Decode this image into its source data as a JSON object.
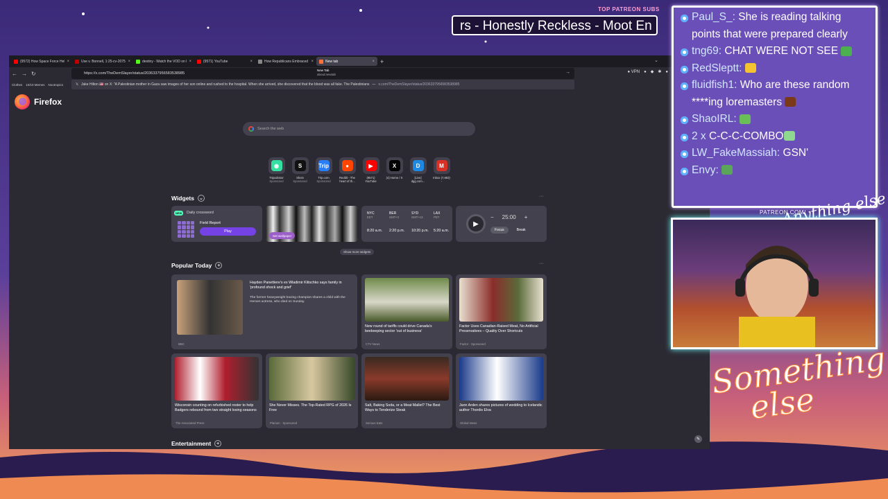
{
  "stream_overlay": {
    "patreon_subs_label": "TOP PATREON SUBS",
    "ticker_text": "rs - Honestly Reckless - Moot En",
    "patreon_url": "PATREON.COM/",
    "signature": "Anything else",
    "logo_text_line1": "Something",
    "logo_text_line2": "else",
    "chat": [
      {
        "user": "Paul_S_:",
        "text": " She is reading talking points that were prepared clearly",
        "emote": ""
      },
      {
        "user": "tng69:",
        "text": " CHAT WERE NOT SEE ",
        "emote": "frog-emote"
      },
      {
        "user": "RedSleptt:",
        "text": " ",
        "emote": "bee-emote"
      },
      {
        "user": "fluidfish1:",
        "text": " Who are these random ****ing loremasters ",
        "emote": "ball-emote"
      },
      {
        "user": "ShaoIRL:",
        "text": " ",
        "emote": "running-emote"
      },
      {
        "user": "2 x",
        "text": " C-C-C-COMBO",
        "emote": "combo-emote"
      },
      {
        "user": "LW_FakeMassiah:",
        "text": " GSN'",
        "emote": ""
      },
      {
        "user": "Envy:",
        "text": " ",
        "emote": "pepe-emote"
      }
    ]
  },
  "browser": {
    "tabs": [
      {
        "label": "(9572) How Space Force Helps",
        "color": "#ff0000"
      },
      {
        "label": "Use v. Bonnell, 1:25-cv-20757",
        "color": "#c00000"
      },
      {
        "label": "destiny - Watch the VOD on Kick",
        "color": "#53fc18"
      },
      {
        "label": "(9571) YouTube",
        "color": "#ff0000"
      },
      {
        "label": "How Republicans Embraced Bri",
        "color": "#888888"
      },
      {
        "label": "New tab",
        "color": "#ff7139"
      }
    ],
    "tooltip_title": "New Tab",
    "tooltip_url": "about:newtab",
    "url": "https://x.com/TheDemSlayer/status/2036337956583538985",
    "suggestion": "Jake Hilton 🇺🇸 on X: \"A Palestinian mother in Gaza saw images of her son online and rushed to the hospital. When she arrived, she discovered that the blood was all fake. The Palestinians",
    "suggestion_url": "x.com/TheDemSlayer/status/2036337956583538985",
    "vpn_label": "VPN",
    "bookmarks": [
      "Clothes",
      "10/10 Memes",
      "Nootropics"
    ],
    "brand": "Firefox",
    "search_placeholder": "Search the web",
    "shortcuts": [
      {
        "name": "Tripadvisor",
        "sub": "Sponsored",
        "glyph": "◉",
        "color": "#34e0a1"
      },
      {
        "name": "Shein",
        "sub": "Sponsored",
        "glyph": "S",
        "color": "#111111"
      },
      {
        "name": "Trip.com",
        "sub": "Sponsored",
        "glyph": "Trip",
        "color": "#287dfa"
      },
      {
        "name": "Reddit - The heart of th...",
        "sub": "",
        "glyph": "●",
        "color": "#ff4500"
      },
      {
        "name": "(9571) YouTube",
        "sub": "",
        "glyph": "▶",
        "color": "#ff0000"
      },
      {
        "name": "(4) Home / X",
        "sub": "",
        "glyph": "X",
        "color": "#000000"
      },
      {
        "name": "[Live] dgg.com...",
        "sub": "",
        "glyph": "D",
        "color": "#1e88e5"
      },
      {
        "name": "Inbox (7,883) -",
        "sub": "",
        "glyph": "M",
        "color": "#d93025"
      }
    ],
    "widgets_label": "Widgets",
    "crossword": {
      "badge": "NEW",
      "title": "Daily crossword",
      "subtitle": "Field Report",
      "play": "Play"
    },
    "wallpaper_button": "Set wallpaper",
    "clocks": [
      {
        "city": "NYC",
        "zone": "EDT",
        "time": "8:20 a.m."
      },
      {
        "city": "BER",
        "zone": "GMT+2",
        "time": "2:20 p.m."
      },
      {
        "city": "SYD",
        "zone": "GMT+13",
        "time": "10:20 p.m."
      },
      {
        "city": "LAX",
        "zone": "PDT",
        "time": "5:20 a.m."
      }
    ],
    "timer": {
      "minus": "−",
      "value": "25:00",
      "plus": "+",
      "focus": "Focus",
      "break": "Break"
    },
    "show_more": "Show more widgets",
    "popular_label": "Popular Today",
    "stories": [
      {
        "title": "Hayden Panettiere's ex Wladimir Klitschko says family in 'profound shock and grief'",
        "desc": "The former heavyweight boxing champion shares a child with the Heroes actress, who died on Sunday.",
        "source": "BBC"
      },
      {
        "title": "New round of tariffs could drive Canada's beekeeping sector 'out of business'",
        "desc": "",
        "source": "CTV News"
      },
      {
        "title": "Factor Uses Canadian-Raised Meat, No Artificial Preservatives – Quality Over Shortcuts",
        "desc": "",
        "source": "Factor · Sponsored"
      },
      {
        "title": "Wisconsin counting on refurbished roster to help Badgers rebound from two straight losing seasons",
        "desc": "",
        "source": "The Associated Press"
      },
      {
        "title": "She Never Misses. The Top-Rated RPG of 2026 Is Free",
        "desc": "",
        "source": "Plarium · Sponsored"
      },
      {
        "title": "Salt, Baking Soda, or a Meat Mallet? The Best Ways to Tenderize Steak",
        "desc": "",
        "source": "Serious Eats"
      },
      {
        "title": "Jann Arden shares pictures of wedding to Icelandic author Thordis Elva",
        "desc": "",
        "source": "Global News"
      }
    ],
    "entertainment_label": "Entertainment"
  }
}
